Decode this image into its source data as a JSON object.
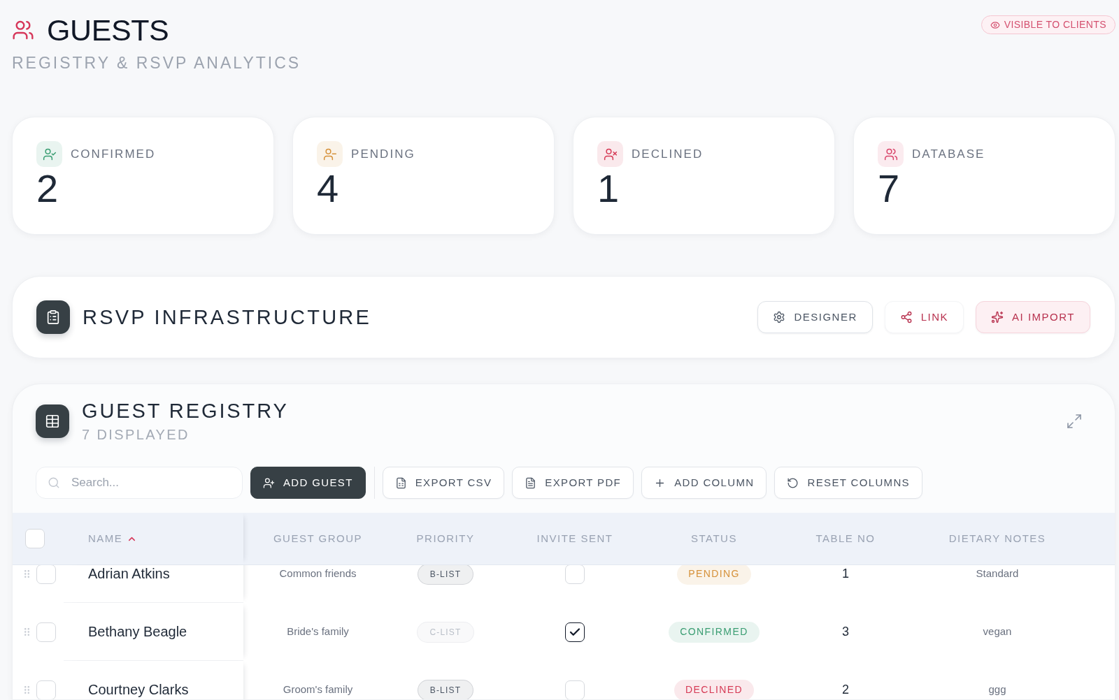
{
  "header": {
    "title": "GUESTS",
    "subtitle": "REGISTRY & RSVP ANALYTICS",
    "visibility_badge": "VISIBLE TO CLIENTS"
  },
  "stats": [
    {
      "kind": "check",
      "label": "CONFIRMED",
      "value": "2",
      "color": "#3a9d72"
    },
    {
      "kind": "minus",
      "label": "PENDING",
      "value": "4",
      "color": "#d6913a"
    },
    {
      "kind": "cross",
      "label": "DECLINED",
      "value": "1",
      "color": "#d63a55"
    },
    {
      "kind": "group",
      "label": "DATABASE",
      "value": "7",
      "color": "#d9456a"
    }
  ],
  "rsvp_infrastructure": {
    "title": "RSVP INFRASTRUCTURE",
    "buttons": [
      {
        "label": "DESIGNER",
        "kind": "outline"
      },
      {
        "label": "LINK",
        "kind": "plain"
      },
      {
        "label": "AI IMPORT",
        "kind": "accent"
      }
    ]
  },
  "guest_registry": {
    "title": "GUEST REGISTRY",
    "count": "7 DISPLAYED",
    "search": {
      "placeholder": "Search..."
    },
    "toolbar": [
      {
        "label": "ADD GUEST",
        "kind": "primary"
      },
      {
        "label": "EXPORT CSV",
        "kind": "outline"
      },
      {
        "label": "EXPORT PDF",
        "kind": "outline"
      },
      {
        "label": "ADD COLUMN",
        "kind": "outline"
      },
      {
        "label": "RESET COLUMNS",
        "kind": "outline"
      }
    ],
    "table": {
      "header_checkbox": {
        "checked": false
      },
      "columns": [
        {
          "label": "NAME",
          "sorted": true
        },
        {
          "label": "GUEST GROUP",
          "sorted": false
        },
        {
          "label": "PRIORITY",
          "sorted": false
        },
        {
          "label": "INVITE SENT",
          "sorted": false
        },
        {
          "label": "STATUS",
          "sorted": false
        },
        {
          "label": "TABLE NO",
          "sorted": false
        },
        {
          "label": "DIETARY NOTES",
          "sorted": false
        }
      ],
      "rows": [
        {
          "selected": false,
          "name": "Adrian Atkins",
          "guest_group": "Common friends",
          "priority": {
            "label": "B-LIST",
            "color": "#4b5563"
          },
          "invite_sent": false,
          "status": {
            "label": "PENDING",
            "color": "#d6913a"
          },
          "table_no": "1",
          "dietary_notes": "Standard"
        },
        {
          "selected": false,
          "name": "Bethany Beagle",
          "guest_group": "Bride's family",
          "priority": {
            "label": "C-LIST",
            "color": "#b9bfc8"
          },
          "invite_sent": true,
          "status": {
            "label": "CONFIRMED",
            "color": "#3a9d72"
          },
          "table_no": "3",
          "dietary_notes": "vegan"
        },
        {
          "selected": false,
          "name": "Courtney Clarks",
          "guest_group": "Groom's family",
          "priority": {
            "label": "B-LIST",
            "color": "#4b5563"
          },
          "invite_sent": false,
          "status": {
            "label": "DECLINED",
            "color": "#d63a55"
          },
          "table_no": "2",
          "dietary_notes": "ggg"
        }
      ]
    }
  }
}
